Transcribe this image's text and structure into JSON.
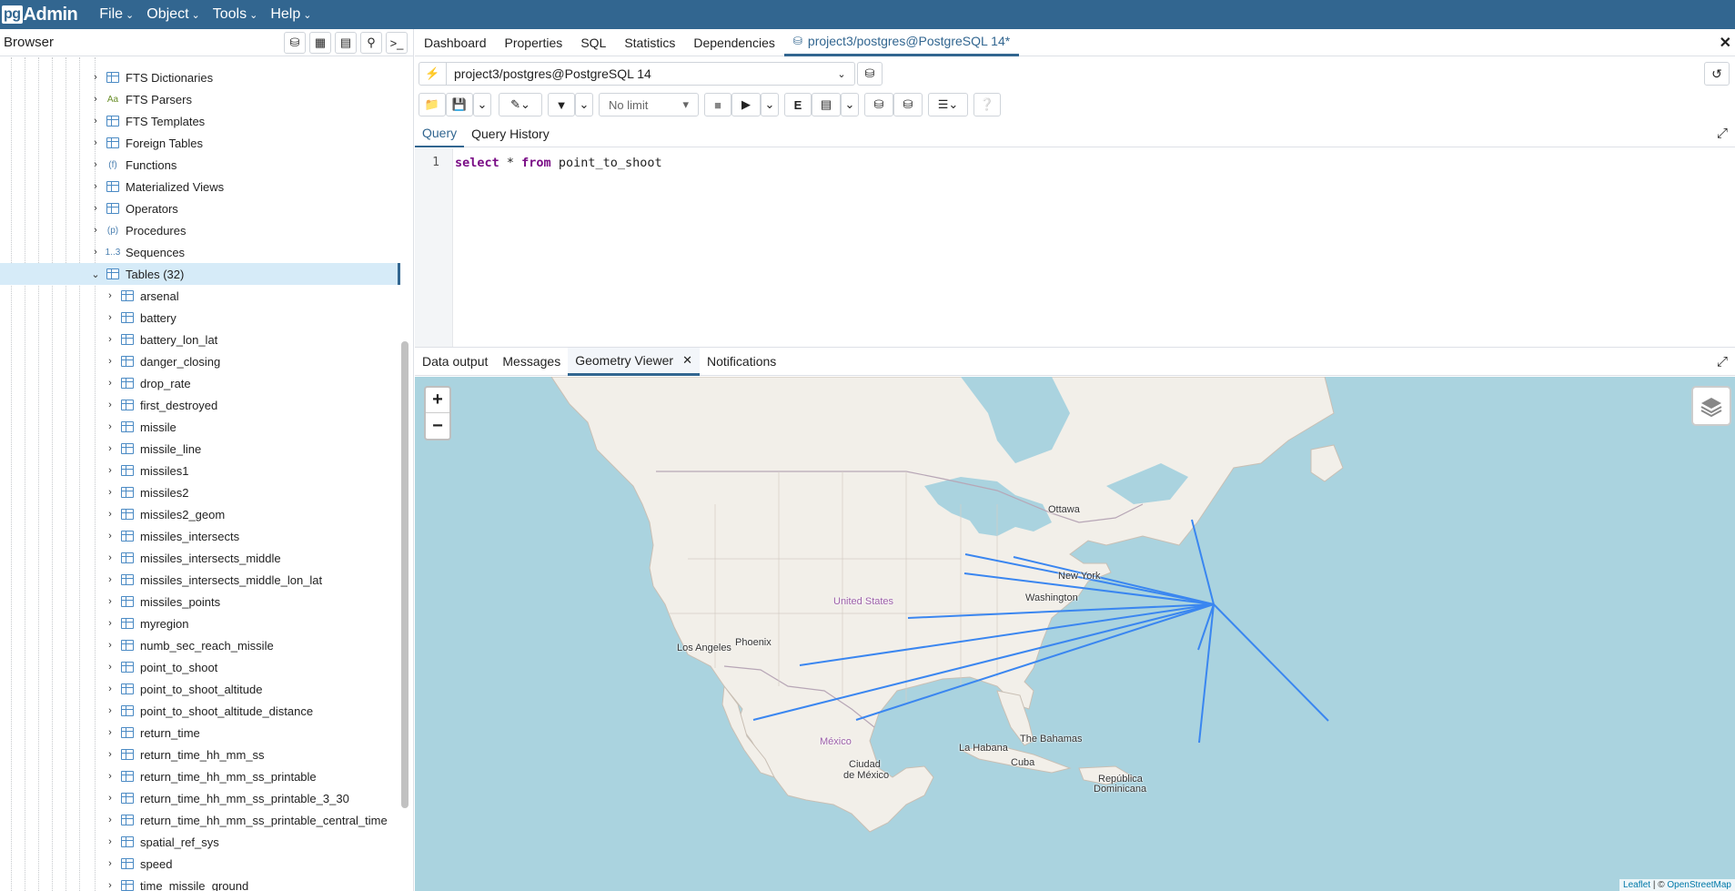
{
  "app": {
    "logo_pg": "pg",
    "logo_text": "Admin"
  },
  "menu": [
    "File",
    "Object",
    "Tools",
    "Help"
  ],
  "browser": {
    "title": "Browser",
    "tree": [
      {
        "label": "FTS Dictionaries",
        "icon": "fts-dictionary-icon"
      },
      {
        "label": "FTS Parsers",
        "icon": "fts-parser-icon",
        "glyph": "Aa"
      },
      {
        "label": "FTS Templates",
        "icon": "fts-template-icon"
      },
      {
        "label": "Foreign Tables",
        "icon": "foreign-table-icon"
      },
      {
        "label": "Functions",
        "icon": "function-icon",
        "glyph": "(f)"
      },
      {
        "label": "Materialized Views",
        "icon": "materialized-view-icon"
      },
      {
        "label": "Operators",
        "icon": "operator-icon"
      },
      {
        "label": "Procedures",
        "icon": "procedure-icon",
        "glyph": "(p)"
      },
      {
        "label": "Sequences",
        "icon": "sequence-icon",
        "glyph": "1..3"
      },
      {
        "label": "Tables (32)",
        "icon": "tables-icon",
        "selected": true
      }
    ],
    "tables": [
      "arsenal",
      "battery",
      "battery_lon_lat",
      "danger_closing",
      "drop_rate",
      "first_destroyed",
      "missile",
      "missile_line",
      "missiles1",
      "missiles2",
      "missiles2_geom",
      "missiles_intersects",
      "missiles_intersects_middle",
      "missiles_intersects_middle_lon_lat",
      "missiles_points",
      "myregion",
      "numb_sec_reach_missile",
      "point_to_shoot",
      "point_to_shoot_altitude",
      "point_to_shoot_altitude_distance",
      "return_time",
      "return_time_hh_mm_ss",
      "return_time_hh_mm_ss_printable",
      "return_time_hh_mm_ss_printable_3_30",
      "return_time_hh_mm_ss_printable_central_time",
      "spatial_ref_sys",
      "speed",
      "time_missile_ground"
    ]
  },
  "tabs": [
    "Dashboard",
    "Properties",
    "SQL",
    "Statistics",
    "Dependencies"
  ],
  "active_tab": "project3/postgres@PostgreSQL 14*",
  "connection": "project3/postgres@PostgreSQL 14",
  "limit": "No limit",
  "query_tabs": [
    "Query",
    "Query History"
  ],
  "editor": {
    "line": "1",
    "kw1": "select",
    "mid": " * ",
    "kw2": "from",
    "rest": " point_to_shoot"
  },
  "output_tabs": [
    "Data output",
    "Messages",
    "Geometry Viewer",
    "Notifications"
  ],
  "map": {
    "labels": {
      "ottawa": "Ottawa",
      "new_york": "New York",
      "washington": "Washington",
      "united_states": "United States",
      "los_angeles": "Los Angeles",
      "phoenix": "Phoenix",
      "mexico": "México",
      "ciudad": "Ciudad",
      "de_mexico": "de México",
      "la_habana": "La Habana",
      "bahamas": "The Bahamas",
      "cuba": "Cuba",
      "republica": "República",
      "dominicana": "Dominicana"
    },
    "attribution_leaflet": "Leaflet",
    "attribution_sep": " | © ",
    "attribution_osm": "OpenStreetMap",
    "line_color": "#3a86f0"
  }
}
